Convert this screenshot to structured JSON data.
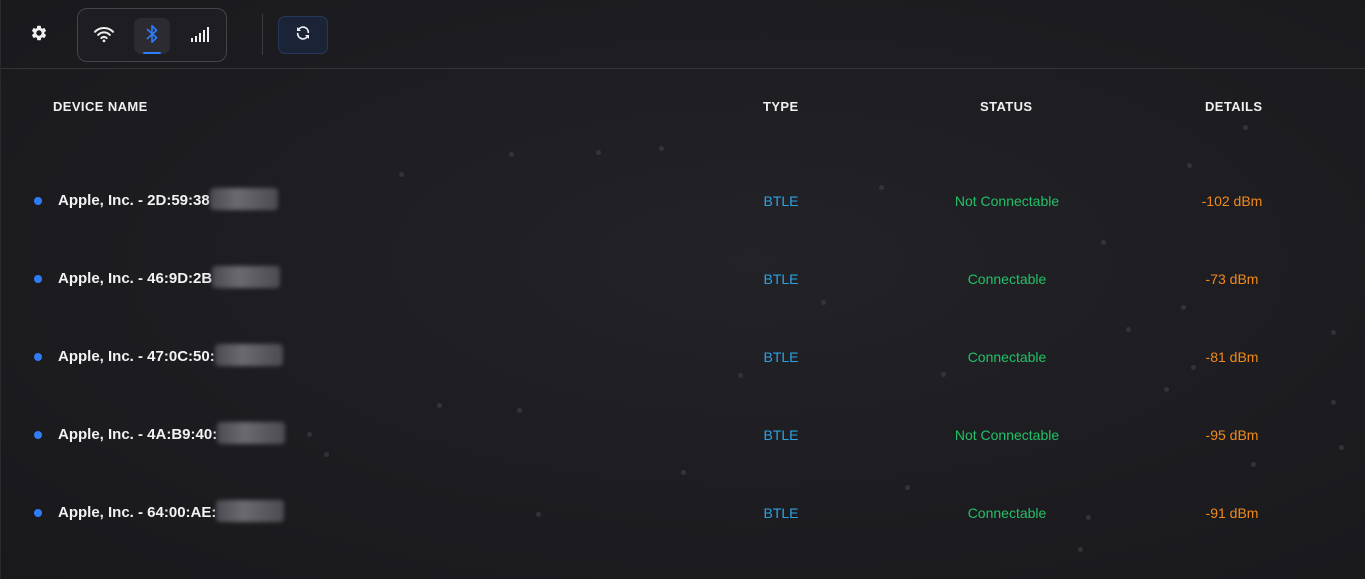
{
  "toolbar": {
    "settings_icon": "gear-icon",
    "modes": [
      {
        "name": "wifi",
        "icon": "wifi-icon",
        "active": false
      },
      {
        "name": "bluetooth",
        "icon": "bluetooth-icon",
        "active": true
      },
      {
        "name": "cellular",
        "icon": "cellular-signal-icon",
        "active": false
      }
    ],
    "refresh_icon": "refresh-icon"
  },
  "table": {
    "headers": {
      "name": "DEVICE NAME",
      "type": "TYPE",
      "status": "STATUS",
      "details": "DETAILS"
    },
    "rows": [
      {
        "name": "Apple, Inc. - 2D:59:38",
        "type": "BTLE",
        "status": "Not Connectable",
        "details": "-102 dBm"
      },
      {
        "name": "Apple, Inc. - 46:9D:2B",
        "type": "BTLE",
        "status": "Connectable",
        "details": "-73 dBm"
      },
      {
        "name": "Apple, Inc. - 47:0C:50:",
        "type": "BTLE",
        "status": "Connectable",
        "details": "-81 dBm"
      },
      {
        "name": "Apple, Inc. - 4A:B9:40:",
        "type": "BTLE",
        "status": "Not Connectable",
        "details": "-95 dBm"
      },
      {
        "name": "Apple, Inc. - 64:00:AE:",
        "type": "BTLE",
        "status": "Connectable",
        "details": "-91 dBm"
      }
    ]
  },
  "colors": {
    "accent": "#2f7cf7",
    "type": "#2aa3e6",
    "status": "#22c067",
    "details": "#f08a1c",
    "background": "#1b1b1e"
  }
}
